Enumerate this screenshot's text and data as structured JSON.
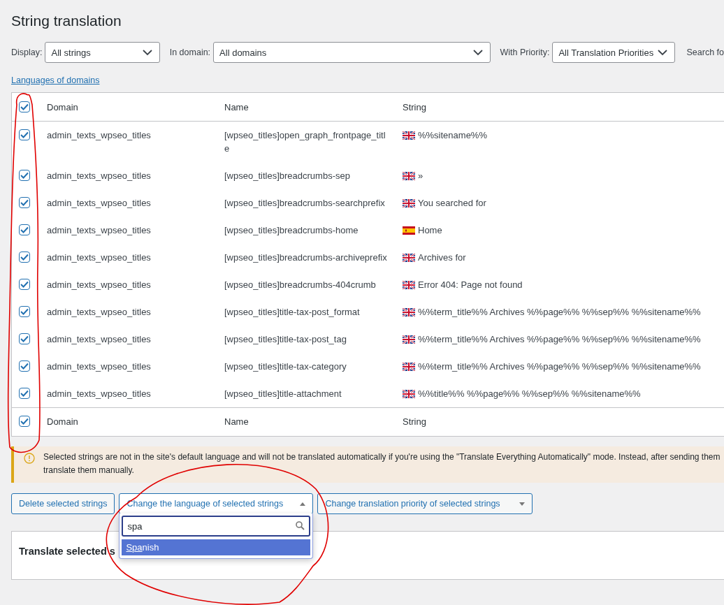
{
  "title": "String translation",
  "filters": [
    {
      "label": "Display:",
      "value": "All strings"
    },
    {
      "label": "In domain:",
      "value": "All domains"
    },
    {
      "label": "With Priority:",
      "value": "All Translation Priorities"
    }
  ],
  "search_label": "Search fo",
  "languages_link": "Languages of domains",
  "table": {
    "columns": [
      "Domain",
      "Name",
      "String"
    ],
    "footer_columns": [
      "Domain",
      "Name",
      "String"
    ],
    "header_checked": true,
    "footer_checked": true,
    "rows": [
      {
        "checked": true,
        "domain": "admin_texts_wpseo_titles",
        "name": "[wpseo_titles]open_graph_frontpage_title",
        "kind": "uk",
        "string": "%%sitename%%"
      },
      {
        "checked": true,
        "domain": "admin_texts_wpseo_titles",
        "name": "[wpseo_titles]breadcrumbs-sep",
        "kind": "uk",
        "string": "»"
      },
      {
        "checked": true,
        "domain": "admin_texts_wpseo_titles",
        "name": "[wpseo_titles]breadcrumbs-searchprefix",
        "kind": "uk",
        "string": "You searched for"
      },
      {
        "checked": true,
        "domain": "admin_texts_wpseo_titles",
        "name": "[wpseo_titles]breadcrumbs-home",
        "kind": "es",
        "string": "Home"
      },
      {
        "checked": true,
        "domain": "admin_texts_wpseo_titles",
        "name": "[wpseo_titles]breadcrumbs-archiveprefix",
        "kind": "uk",
        "string": "Archives for"
      },
      {
        "checked": true,
        "domain": "admin_texts_wpseo_titles",
        "name": "[wpseo_titles]breadcrumbs-404crumb",
        "kind": "uk",
        "string": "Error 404: Page not found"
      },
      {
        "checked": true,
        "domain": "admin_texts_wpseo_titles",
        "name": "[wpseo_titles]title-tax-post_format",
        "kind": "uk",
        "string": "%%term_title%% Archives %%page%% %%sep%% %%sitename%%"
      },
      {
        "checked": true,
        "domain": "admin_texts_wpseo_titles",
        "name": "[wpseo_titles]title-tax-post_tag",
        "kind": "uk",
        "string": "%%term_title%% Archives %%page%% %%sep%% %%sitename%%"
      },
      {
        "checked": true,
        "domain": "admin_texts_wpseo_titles",
        "name": "[wpseo_titles]title-tax-category",
        "kind": "uk",
        "string": "%%term_title%% Archives %%page%% %%sep%% %%sitename%%"
      },
      {
        "checked": true,
        "domain": "admin_texts_wpseo_titles",
        "name": "[wpseo_titles]title-attachment",
        "kind": "uk",
        "string": "%%title%% %%page%% %%sep%% %%sitename%%"
      }
    ]
  },
  "notice": {
    "lines": [
      "Selected strings are not in the site's default language and will not be translated automatically if you're using the \"Translate Everything Automatically\" mode. Instead, after sending them",
      "translate them manually."
    ]
  },
  "bulk_actions": [
    {
      "kind": "button",
      "label": "Delete selected strings"
    },
    {
      "kind": "select",
      "label": "Change the language of selected strings",
      "open": true
    },
    {
      "kind": "select",
      "label": "Change translation priority of selected strings",
      "open": false
    }
  ],
  "language_dropdown": {
    "search_value": "spa",
    "options": [
      {
        "match": "Spa",
        "rest": "nish",
        "selected": true
      }
    ]
  },
  "translate_panel": {
    "heading": "Translate selected s"
  }
}
